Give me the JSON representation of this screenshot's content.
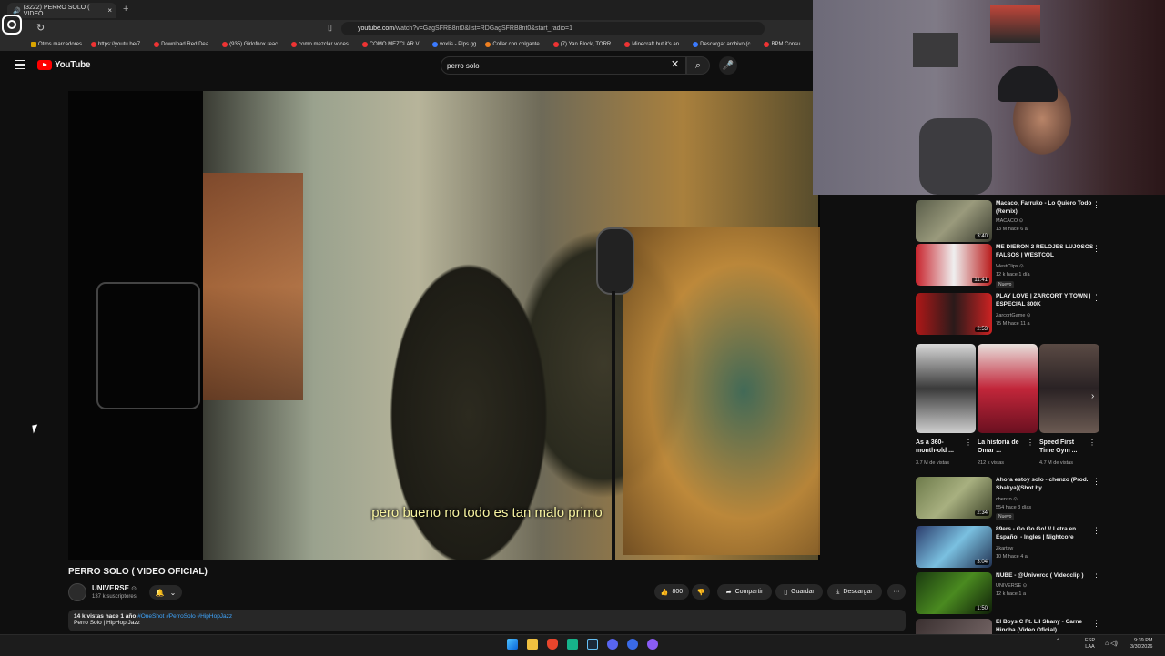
{
  "browser": {
    "tab_title": "(3222) PERRO SOLO ( VIDEO",
    "tab_close": "×",
    "new_tab": "+",
    "url_host": "youtube.com",
    "url_path": "/watch?v=GagSFRB8nt0&list=RDGagSFRB8nt0&start_radio=1",
    "bookmarks": [
      "Otros marcadores",
      "https://youtu.be/7...",
      "Download Red Dea...",
      "(935) Girlofnox reac...",
      "como mezclar voces...",
      "COMO MEZCLAR V...",
      "voxlis - Plps.gg",
      "Collar con colgante...",
      "(7) Yan Block, TORR...",
      "Minecraft but it's an...",
      "Descargar archivo (c...",
      "BPM Consu"
    ]
  },
  "youtube": {
    "logo_text": "YouTube",
    "search_value": "perro solo",
    "clear_glyph": "✕",
    "search_glyph": "⌕",
    "mic_glyph": "🎤"
  },
  "player": {
    "subtitle": "pero bueno no todo es tan malo primo"
  },
  "video": {
    "title": "PERRO SOLO ( VIDEO OFICIAL)",
    "channel": "UNIVERSE",
    "verified": "⊙",
    "subscribers": "137 k suscriptores",
    "bell": "🔔",
    "chevron": "⌄",
    "likes": "800",
    "like_glyph": "👍",
    "dislike_glyph": "👎",
    "share": "Compartir",
    "share_glyph": "➦",
    "save": "Guardar",
    "save_glyph": "▯",
    "download": "Descargar",
    "download_glyph": "⤓",
    "more": "···",
    "views_line": "14 k vistas  hace 1 año",
    "tags": "#OneShot #PerroSolo #HipHopJazz",
    "desc_line": "Perro Solo | HipHop Jazz"
  },
  "recommendations": [
    {
      "title": "Macaco, Farruko - Lo Quiero Todo (Remix)",
      "channel": "MACACO ⊙",
      "meta": "13 M  hace 6 a",
      "duration": "3:40",
      "nuevo": ""
    },
    {
      "title": "ME DIERON 2 RELOJES LUJOSOS FALSOS | WESTCOL",
      "channel": "WestClips ⊙",
      "meta": "12 k  hace 1 día",
      "duration": "11:41",
      "nuevo": "Nuevo"
    },
    {
      "title": "PLAY LOVE | ZARCORT Y TOWN | ESPECIAL 800K",
      "channel": "ZarcortGame ⊙",
      "meta": "75 M  hace 11 a",
      "duration": "2:53",
      "nuevo": ""
    },
    {
      "title": "Ahora estoy solo - chenzo (Prod. Shakya)(Shot by ...",
      "channel": "chenzo ⊙",
      "meta": "554  hace 3 días",
      "duration": "2:34",
      "nuevo": "Nuevo"
    },
    {
      "title": "89ers - Go Go Go! // Letra en Español - Ingles | Nightcore",
      "channel": "Zkartsw",
      "meta": "10 M  hace 4 a",
      "duration": "3:04",
      "nuevo": ""
    },
    {
      "title": "NUBE - @Univercc ( Videoclip )",
      "channel": "UNIVERSE ⊙",
      "meta": "12 k  hace 1 a",
      "duration": "1:50",
      "nuevo": ""
    },
    {
      "title": "El Boys C Ft. Lil Shany - Carne Hincha (Video Oficial)",
      "channel": "",
      "meta": "",
      "duration": "",
      "nuevo": ""
    }
  ],
  "shorts": [
    {
      "title": "As a 360-month-old ...",
      "views": "3.7 M de vistas"
    },
    {
      "title": "La historia de Omar ...",
      "views": "212 k vistas"
    },
    {
      "title": "Speed First Time Gym ...",
      "views": "4.7 M de vistas"
    }
  ],
  "shorts_next": "›",
  "menu_dots": "⋮",
  "taskbar": {
    "lang_top": "ESP",
    "lang_bottom": "LAA",
    "time": "9:39 PM",
    "date": "3/30/2026",
    "tray_up": "⌃"
  }
}
